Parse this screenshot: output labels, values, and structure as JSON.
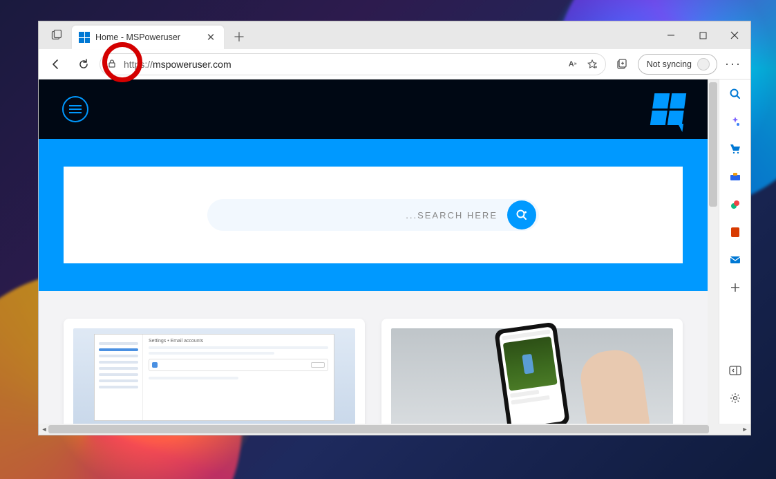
{
  "browser": {
    "tab": {
      "title": "Home - MSPoweruser"
    },
    "url_scheme": "https://",
    "url_host": "mspoweruser.com",
    "sync_label": "Not syncing"
  },
  "sidebar_icons": [
    "search-icon",
    "copilot-icon",
    "shopping-icon",
    "tools-icon",
    "games-icon",
    "office-icon",
    "outlook-icon"
  ],
  "page": {
    "search_placeholder": "...SEARCH HERE"
  }
}
